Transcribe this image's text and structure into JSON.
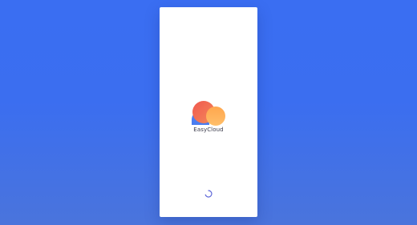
{
  "app": {
    "name": "EasyCloud"
  },
  "colors": {
    "background": "#3a6ef2",
    "screen": "#ffffff",
    "cloud_blue": "#4a7df0",
    "cloud_coral": "#f26b5b",
    "cloud_orange": "#ffb35a",
    "spinner": "#5b64d8"
  },
  "icons": {
    "logo": "cloud-logo-icon",
    "loader": "loading-spinner-icon"
  }
}
